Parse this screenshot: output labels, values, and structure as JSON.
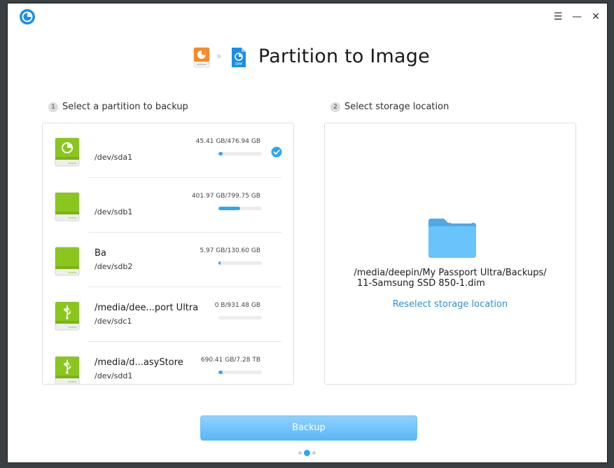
{
  "window": {
    "title": "Partition to Image",
    "controls": [
      "menu-icon",
      "minimize-icon",
      "close-icon"
    ]
  },
  "steps": {
    "step1": {
      "number": "1",
      "label": "Select a partition to backup"
    },
    "step2": {
      "number": "2",
      "label": "Select storage location"
    }
  },
  "partitions": [
    {
      "name": "",
      "device": "/dev/sda1",
      "size": "45.41 GB/476.94 GB",
      "usage": 0.095,
      "selected": true,
      "icon": "deepin-disk-icon"
    },
    {
      "name": "",
      "device": "/dev/sdb1",
      "size": "401.97 GB/799.75 GB",
      "usage": 0.5,
      "selected": false,
      "icon": "disk-icon"
    },
    {
      "name": "Ba",
      "device": "/dev/sdb2",
      "size": "5.97 GB/130.60 GB",
      "usage": 0.046,
      "selected": false,
      "icon": "disk-icon"
    },
    {
      "name": "/media/dee...port Ultra",
      "device": "/dev/sdc1",
      "size": "0 B/931.48 GB",
      "usage": 0.0,
      "selected": false,
      "icon": "usb-disk-icon"
    },
    {
      "name": "/media/d...asyStore",
      "device": "/dev/sdd1",
      "size": "690.41 GB/7.28 TB",
      "usage": 0.095,
      "selected": false,
      "icon": "usb-disk-icon"
    }
  ],
  "storage": {
    "path_line1": "/media/deepin/My Passport Ultra/Backups/",
    "path_line2": "11-Samsung SSD 850-1.dim",
    "reselect_label": "Reselect storage location"
  },
  "backup_label": "Backup",
  "pagination": {
    "total": 3,
    "current": 2
  },
  "colors": {
    "accent": "#2ca7f8",
    "disk_green": "#8bc61e",
    "folder": "#5cbcf9",
    "link": "#2b8fd8"
  }
}
